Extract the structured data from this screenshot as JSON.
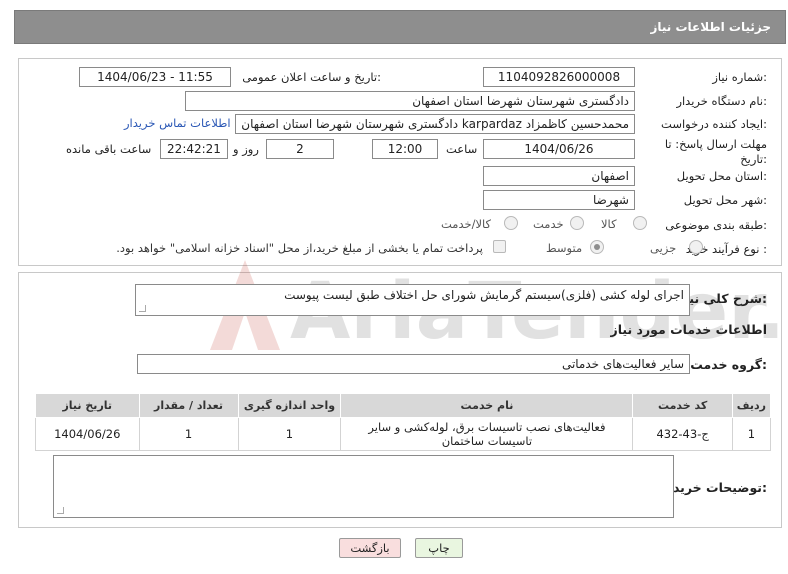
{
  "header": {
    "title": "جزئیات اطلاعات نیاز"
  },
  "form": {
    "need_number": {
      "label": "شماره نیاز:",
      "value": "1104092826000008"
    },
    "announce_datetime": {
      "label": "تاریخ و ساعت اعلان عمومی:",
      "value": "1404/06/23 - 11:55"
    },
    "buyer_org": {
      "label": "نام دستگاه خریدار:",
      "value": "دادگستری شهرستان شهرضا استان اصفهان"
    },
    "requester": {
      "label": "ایجاد کننده درخواست:",
      "value": "محمدحسین کاظمزاد karpardaz دادگستری شهرستان شهرضا استان اصفهان",
      "contact_link": "اطلاعات تماس خریدار"
    },
    "deadline": {
      "label": "مهلت ارسال پاسخ: تا تاریخ:",
      "date": "1404/06/26",
      "time_label": "ساعت",
      "time": "12:00",
      "days": "2",
      "days_label": "روز و",
      "remaining": "22:42:21",
      "remaining_label": "ساعت باقی مانده"
    },
    "delivery_province": {
      "label": "استان محل تحویل:",
      "value": "اصفهان"
    },
    "delivery_city": {
      "label": "شهر محل تحویل:",
      "value": "شهرضا"
    },
    "category": {
      "label": "طبقه بندی موضوعی:",
      "options": [
        "کالا",
        "خدمت",
        "کالا/خدمت"
      ]
    },
    "process": {
      "label": "نوع فرآیند خرید :",
      "options": [
        "جزیی",
        "متوسط"
      ],
      "payment_note": "پرداخت تمام یا بخشی از مبلغ خرید،از محل \"اسناد خزانه اسلامی\" خواهد بود."
    }
  },
  "summary": {
    "label": "شرح کلی نیاز:",
    "value": "اجرای لوله کشی (فلزی)سیستم گرمایش شورای حل اختلاف طبق لیست پیوست"
  },
  "services": {
    "section_title": "اطلاعات خدمات مورد نیاز",
    "group_label": "گروه خدمت:",
    "group_value": "سایر فعالیت‌های خدماتی",
    "columns": [
      "ردیف",
      "کد خدمت",
      "نام خدمت",
      "واحد اندازه گیری",
      "تعداد / مقدار",
      "تاریخ نیاز"
    ],
    "rows": [
      [
        "1",
        "ج-43-432",
        "فعالیت‌های نصب تاسیسات برق، لوله‌کشی و سایر تاسیسات ساختمان",
        "1",
        "1",
        "1404/06/26"
      ]
    ]
  },
  "buyer_notes": {
    "label": "توضیحات خریدار:",
    "value": ""
  },
  "buttons": {
    "print": "چاپ",
    "back": "بازگشت"
  },
  "watermark": {
    "text": "AriaTender.net"
  }
}
